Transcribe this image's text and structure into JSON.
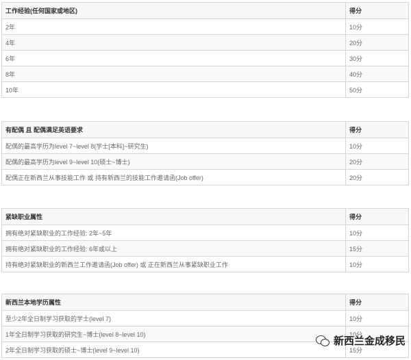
{
  "tables": [
    {
      "header": [
        "工作经验(任何国家或地区)",
        "得分"
      ],
      "rows": [
        [
          "2年",
          "10分"
        ],
        [
          "4年",
          "20分"
        ],
        [
          "6年",
          "30分"
        ],
        [
          "8年",
          "40分"
        ],
        [
          "10年",
          "50分"
        ]
      ]
    },
    {
      "header": [
        "有配偶 且 配偶满足英语要求",
        "得分"
      ],
      "rows": [
        [
          "配偶的最高学历为level 7~level 8(学士[本科]~研究生)",
          "10分"
        ],
        [
          "配偶的最高学历为level 9~level 10(硕士~博士)",
          "20分"
        ],
        [
          "配偶正在新西兰从事技能工作 或 持有新西兰的技能工作邀请函(Job offer)",
          "20分"
        ]
      ]
    },
    {
      "header": [
        "紧缺职业属性",
        "得分"
      ],
      "rows": [
        [
          "拥有绝对紧缺职业的工作经验: 2年~5年",
          "10分"
        ],
        [
          "拥有绝对紧缺职业的工作经验: 6年或以上",
          "15分"
        ],
        [
          "持有绝对紧缺职业的新西兰工作邀请函(Job offer) 或 正在新西兰从事紧缺职业工作",
          "10分"
        ]
      ]
    },
    {
      "header": [
        "新西兰本地学历属性",
        "得分"
      ],
      "rows": [
        [
          "至少2年全日制学习获取的学士(level 7)",
          "10分"
        ],
        [
          "1年全日制学习获取的研究生~博士(level 8~level 10)",
          "10分"
        ],
        [
          "2年全日制学习获取的硕士~博士(level 9~level 10)",
          "15分"
        ]
      ]
    }
  ],
  "watermark": {
    "text": "新西兰金成移民",
    "icon": "wechat-icon"
  }
}
